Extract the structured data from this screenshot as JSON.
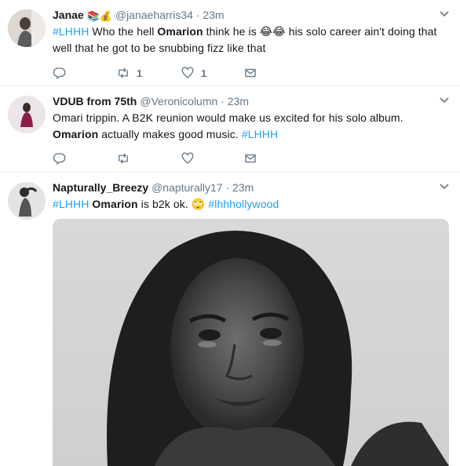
{
  "tweets": [
    {
      "name": "Janae",
      "badges": "📚💰",
      "handle": "@janaeharris34",
      "dot": "·",
      "time": "23m",
      "text": {
        "hashtag": "#LHHH",
        "part1": " Who the hell ",
        "bold": "Omarion",
        "part2": " think he is ",
        "emoji": "😂😂",
        "part3": " his solo career ain't doing that well that he got to be snubbing fizz like that"
      },
      "retweet_count": "1",
      "like_count": "1"
    },
    {
      "name": "VDUB from 75th",
      "handle": "@Veronicolumn",
      "dot": "·",
      "time": "23m",
      "text": {
        "part1": "Omari trippin. A B2K reunion would make us excited for his solo album. ",
        "bold": "Omarion",
        "part2": " actually makes good music. ",
        "hashtag": "#LHHH"
      },
      "retweet_count": "",
      "like_count": ""
    },
    {
      "name": "Napturally_Breezy",
      "handle": "@napturally17",
      "dot": "·",
      "time": "23m",
      "text": {
        "hashtag": "#LHHH",
        "part1": " ",
        "bold": "Omarion",
        "part2": " is b2k ok. ",
        "emoji": "🙄",
        "part3": " ",
        "hashtag2": "#lhhhollywood"
      }
    }
  ],
  "icons": [
    "chevron-down-icon",
    "reply-icon",
    "retweet-icon",
    "like-icon",
    "direct-message-icon"
  ],
  "colors": {
    "link": "#1da1f2",
    "secondary": "#657786",
    "divider": "#e6ecf0",
    "text": "#14171a"
  }
}
